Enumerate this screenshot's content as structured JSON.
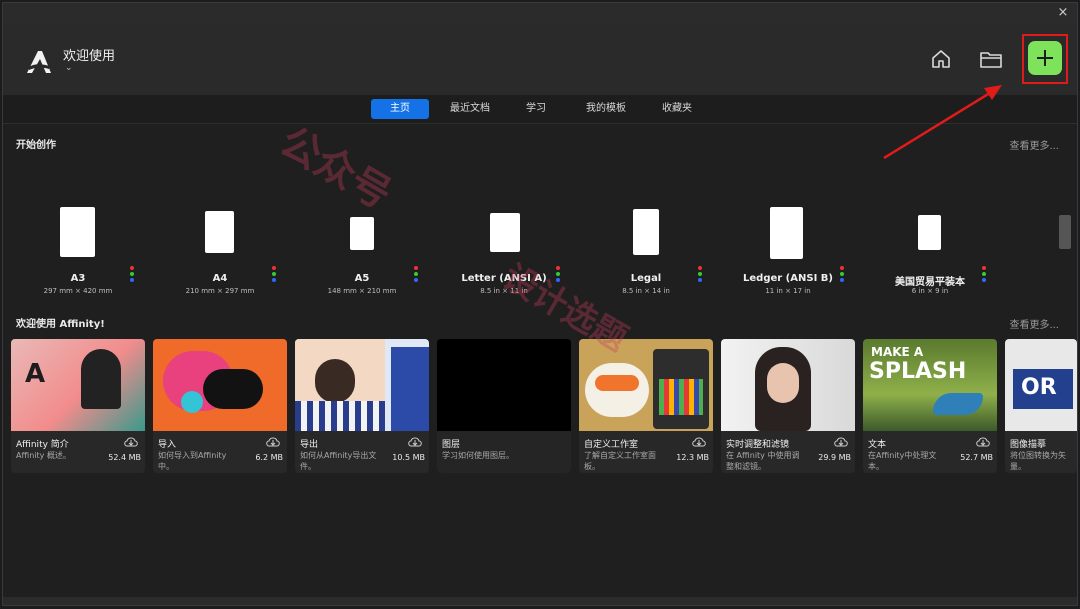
{
  "window": {
    "close_glyph": "×"
  },
  "header": {
    "app_title": "欢迎使用",
    "title_chevron": "⌄",
    "home_icon": "home-icon",
    "folder_icon": "folder-icon",
    "new_icon": "plus-icon",
    "accent": "#7fe25b",
    "highlight": "#e01b1b"
  },
  "tabs": [
    {
      "label": "主页",
      "active": true
    },
    {
      "label": "最近文档",
      "active": false
    },
    {
      "label": "学习",
      "active": false
    },
    {
      "label": "我的模板",
      "active": false
    },
    {
      "label": "收藏夹",
      "active": false
    }
  ],
  "create": {
    "title": "开始创作",
    "see_more": "查看更多...",
    "templates": [
      {
        "name": "A3",
        "size": "297 mm × 420 mm"
      },
      {
        "name": "A4",
        "size": "210 mm × 297 mm"
      },
      {
        "name": "A5",
        "size": "148 mm × 210 mm"
      },
      {
        "name": "Letter (ANSI A)",
        "size": "8.5 in × 11 in"
      },
      {
        "name": "Legal",
        "size": "8.5 in × 14 in"
      },
      {
        "name": "Ledger (ANSI B)",
        "size": "11 in × 17 in"
      },
      {
        "name": "美国贸易平装本",
        "size": "6 in × 9 in"
      }
    ]
  },
  "welcome": {
    "title": "欢迎使用 Affinity!",
    "see_more": "查看更多...",
    "cards": [
      {
        "title": "Affinity 简介",
        "subtitle": "Affinity 概述。",
        "size": "52.4 MB"
      },
      {
        "title": "导入",
        "subtitle": "如何导入到Affinity中。",
        "size": "6.2 MB"
      },
      {
        "title": "导出",
        "subtitle": "如何从Affinity导出文件。",
        "size": "10.5 MB"
      },
      {
        "title": "图层",
        "subtitle": "学习如何使用图层。",
        "size": ""
      },
      {
        "title": "自定义工作室",
        "subtitle": "了解自定义工作室面板。",
        "size": "12.3 MB"
      },
      {
        "title": "实时调整和滤镜",
        "subtitle": "在 Affinity 中使用调整和滤镜。",
        "size": "29.9 MB"
      },
      {
        "title": "文本",
        "subtitle": "在Affinity中处理文本。",
        "size": "52.7 MB"
      },
      {
        "title": "图像描摹",
        "subtitle": "将位图转换为矢量。",
        "size": ""
      }
    ]
  },
  "watermark": {
    "text1": "公众号",
    "text2": "设计选题"
  }
}
